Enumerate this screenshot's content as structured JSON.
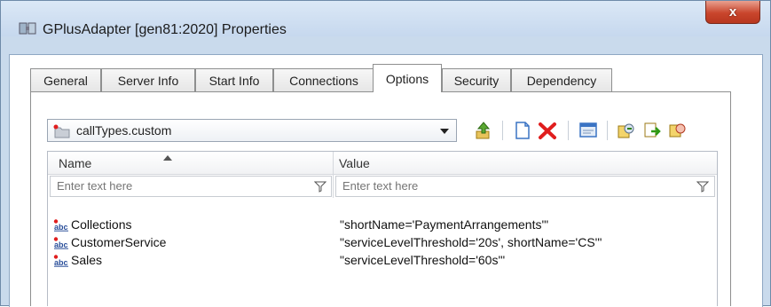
{
  "window": {
    "title": "GPlusAdapter [gen81:2020] Properties",
    "close_symbol": "x"
  },
  "tabs": [
    {
      "label": "General",
      "active": false
    },
    {
      "label": "Server Info",
      "active": false
    },
    {
      "label": "Start Info",
      "active": false
    },
    {
      "label": "Connections",
      "active": false
    },
    {
      "label": "Options",
      "active": true
    },
    {
      "label": "Security",
      "active": false
    },
    {
      "label": "Dependency",
      "active": false
    }
  ],
  "options": {
    "section_selector": {
      "value": "callTypes.custom",
      "icon": "folder-icon"
    },
    "toolbar": [
      {
        "name": "up-level-icon"
      },
      {
        "name": "new-icon"
      },
      {
        "name": "delete-icon"
      },
      {
        "name": "properties-icon"
      },
      {
        "name": "import-icon"
      },
      {
        "name": "export-icon"
      },
      {
        "name": "copy-icon"
      }
    ],
    "grid": {
      "columns": [
        {
          "label": "Name",
          "sorted": "ascending"
        },
        {
          "label": "Value"
        }
      ],
      "filters": [
        {
          "placeholder": "Enter text here"
        },
        {
          "placeholder": "Enter text here"
        }
      ],
      "rows": [
        {
          "name": "Collections",
          "value": "\"shortName='PaymentArrangements'\""
        },
        {
          "name": "CustomerService",
          "value": "\"serviceLevelThreshold='20s', shortName='CS'\""
        },
        {
          "name": "Sales",
          "value": "\"serviceLevelThreshold='60s'\""
        }
      ]
    }
  },
  "colors": {
    "window_frame": "#c9daec",
    "close_button": "#c9452c",
    "delete_icon": "#e01e1e",
    "up_icon": "#e0a21a"
  }
}
